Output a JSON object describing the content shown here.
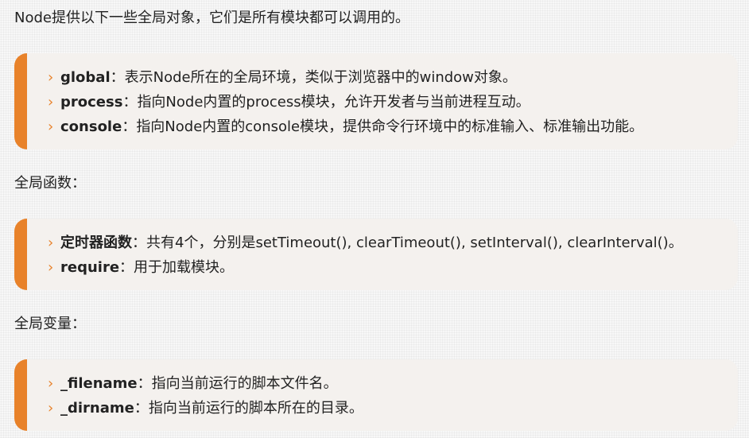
{
  "intro": "Node提供以下一些全局对象，它们是所有模块都可以调用的。",
  "objects": [
    {
      "key": "global",
      "sep": "：",
      "desc": "表示Node所在的全局环境，类似于浏览器中的window对象。"
    },
    {
      "key": "process",
      "sep": "：",
      "desc": "指向Node内置的process模块，允许开发者与当前进程互动。"
    },
    {
      "key": "console",
      "sep": "：",
      "desc": "指向Node内置的console模块，提供命令行环境中的标准输入、标准输出功能。"
    }
  ],
  "functions_heading": "全局函数：",
  "functions": [
    {
      "key": "定时器函数",
      "sep": "：",
      "desc": "共有4个，分别是setTimeout(), clearTimeout(), setInterval(), clearInterval()。"
    },
    {
      "key": "require",
      "sep": "：",
      "desc": "用于加载模块。"
    }
  ],
  "variables_heading": "全局变量：",
  "variables": [
    {
      "key": "_filename",
      "sep": "：",
      "desc": "指向当前运行的脚本文件名。"
    },
    {
      "key": "_dirname",
      "sep": "：",
      "desc": "指向当前运行的脚本所在的目录。"
    }
  ],
  "bullet_glyph": "›",
  "accent_color": "#e8822a",
  "box_background": "#f4f1ee"
}
